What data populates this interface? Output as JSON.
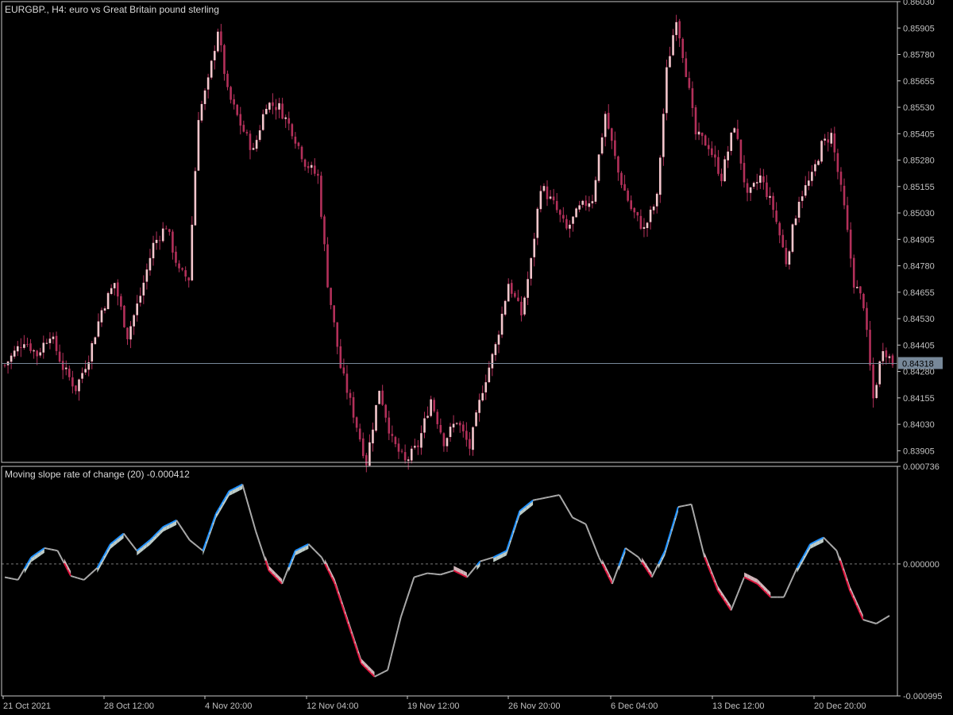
{
  "main_panel": {
    "title": "EURGBP., H4:  euro vs Great Britain pound sterling",
    "y_ticks": [
      "0.86030",
      "0.85905",
      "0.85780",
      "0.85655",
      "0.85530",
      "0.85405",
      "0.85280",
      "0.85155",
      "0.85030",
      "0.84905",
      "0.84780",
      "0.84655",
      "0.84530",
      "0.84405",
      "0.84280",
      "0.84155",
      "0.84030",
      "0.83905"
    ],
    "current_price": "0.84318"
  },
  "sub_panel": {
    "title": "Moving slope rate of change (20) -0.000412",
    "y_ticks": [
      "0.000736",
      "0.000000",
      "-0.000995"
    ]
  },
  "x_axis": {
    "labels": [
      "21 Oct 2021",
      "28 Oct 12:00",
      "4 Nov 20:00",
      "12 Nov 04:00",
      "19 Nov 12:00",
      "26 Nov 20:00",
      "6 Dec 04:00",
      "13 Dec 12:00",
      "20 Dec 20:00"
    ]
  },
  "colors": {
    "background": "#000000",
    "grid": "#c8c8c8",
    "candle_body": "#f4c6cc",
    "candle_wick": "#b3305a",
    "candle_bull_accent": "#22c55e",
    "indicator_neutral": "#a9a9a9",
    "indicator_up": "#1e90ff",
    "indicator_down": "#dc143c",
    "fill_up": "#dff0ea",
    "fill_down": "#f6d6da",
    "zero_line": "#7a7a7a",
    "price_tag_bg": "#778899"
  },
  "chart_data": [
    {
      "type": "candlestick",
      "title": "EURGBP., H4:  euro vs Great Britain pound sterling",
      "ylim": [
        0.8385,
        0.8603
      ],
      "x_range": [
        "21 Oct 2021",
        "23 Dec 2021"
      ],
      "current_price": 0.84318,
      "close_path": [
        [
          0,
          0.8431
        ],
        [
          6,
          0.8443
        ],
        [
          10,
          0.8436
        ],
        [
          14,
          0.8446
        ],
        [
          18,
          0.843
        ],
        [
          22,
          0.842
        ],
        [
          26,
          0.8435
        ],
        [
          30,
          0.8457
        ],
        [
          34,
          0.847
        ],
        [
          38,
          0.8445
        ],
        [
          42,
          0.8464
        ],
        [
          46,
          0.8488
        ],
        [
          50,
          0.8497
        ],
        [
          54,
          0.8475
        ],
        [
          57,
          0.8472
        ],
        [
          60,
          0.8549
        ],
        [
          63,
          0.8565
        ],
        [
          66,
          0.859
        ],
        [
          69,
          0.856
        ],
        [
          73,
          0.8545
        ],
        [
          77,
          0.8532
        ],
        [
          81,
          0.8555
        ],
        [
          85,
          0.8553
        ],
        [
          89,
          0.8542
        ],
        [
          93,
          0.8527
        ],
        [
          97,
          0.852
        ],
        [
          100,
          0.847
        ],
        [
          104,
          0.843
        ],
        [
          108,
          0.8408
        ],
        [
          112,
          0.8385
        ],
        [
          116,
          0.842
        ],
        [
          120,
          0.8395
        ],
        [
          124,
          0.8385
        ],
        [
          128,
          0.8393
        ],
        [
          132,
          0.8415
        ],
        [
          136,
          0.8395
        ],
        [
          140,
          0.8405
        ],
        [
          144,
          0.8392
        ],
        [
          148,
          0.842
        ],
        [
          152,
          0.844
        ],
        [
          156,
          0.847
        ],
        [
          160,
          0.8455
        ],
        [
          163,
          0.848
        ],
        [
          166,
          0.8516
        ],
        [
          170,
          0.8507
        ],
        [
          174,
          0.8495
        ],
        [
          178,
          0.8505
        ],
        [
          182,
          0.851
        ],
        [
          186,
          0.855
        ],
        [
          190,
          0.8522
        ],
        [
          194,
          0.8505
        ],
        [
          198,
          0.8495
        ],
        [
          202,
          0.851
        ],
        [
          205,
          0.857
        ],
        [
          208,
          0.8596
        ],
        [
          211,
          0.857
        ],
        [
          214,
          0.854
        ],
        [
          218,
          0.8535
        ],
        [
          222,
          0.852
        ],
        [
          226,
          0.8545
        ],
        [
          230,
          0.851
        ],
        [
          234,
          0.852
        ],
        [
          238,
          0.8505
        ],
        [
          242,
          0.848
        ],
        [
          246,
          0.851
        ],
        [
          250,
          0.852
        ],
        [
          253,
          0.8535
        ],
        [
          256,
          0.854
        ],
        [
          260,
          0.8505
        ],
        [
          263,
          0.847
        ],
        [
          266,
          0.846
        ],
        [
          269,
          0.8415
        ],
        [
          272,
          0.844
        ],
        [
          275,
          0.8432
        ]
      ]
    },
    {
      "type": "line",
      "title": "Moving slope rate of change (20) -0.000412",
      "ylim": [
        -0.000995,
        0.000736
      ],
      "current_value": -0.000412,
      "points": [
        [
          0,
          -0.0001
        ],
        [
          4,
          -0.00012
        ],
        [
          8,
          5e-05
        ],
        [
          12,
          0.00012
        ],
        [
          16,
          0.0001
        ],
        [
          20,
          -9e-05
        ],
        [
          24,
          -0.00012
        ],
        [
          28,
          -3e-05
        ],
        [
          32,
          0.00015
        ],
        [
          36,
          0.00023
        ],
        [
          40,
          0.0001
        ],
        [
          44,
          0.00018
        ],
        [
          48,
          0.00028
        ],
        [
          52,
          0.00033
        ],
        [
          56,
          0.00018
        ],
        [
          60,
          0.0001
        ],
        [
          64,
          0.00038
        ],
        [
          68,
          0.00055
        ],
        [
          72,
          0.0006
        ],
        [
          76,
          0.00025
        ],
        [
          80,
          -5e-05
        ],
        [
          84,
          -0.00015
        ],
        [
          88,
          0.0001
        ],
        [
          92,
          0.00015
        ],
        [
          96,
          5e-05
        ],
        [
          100,
          -0.00015
        ],
        [
          104,
          -0.00045
        ],
        [
          108,
          -0.00075
        ],
        [
          112,
          -0.00085
        ],
        [
          116,
          -0.0008
        ],
        [
          120,
          -0.0004
        ],
        [
          124,
          -0.0001
        ],
        [
          128,
          -7e-05
        ],
        [
          132,
          -8e-05
        ],
        [
          136,
          -5e-05
        ],
        [
          140,
          -0.0001
        ],
        [
          144,
          2e-05
        ],
        [
          148,
          5e-05
        ],
        [
          152,
          0.0001
        ],
        [
          156,
          0.0004
        ],
        [
          160,
          0.00048
        ],
        [
          164,
          0.0005
        ],
        [
          168,
          0.00052
        ],
        [
          172,
          0.00035
        ],
        [
          176,
          0.0003
        ],
        [
          180,
          5e-05
        ],
        [
          184,
          -0.00015
        ],
        [
          188,
          0.00012
        ],
        [
          192,
          5e-05
        ],
        [
          196,
          -0.0001
        ],
        [
          200,
          0.0001
        ],
        [
          204,
          0.00043
        ],
        [
          208,
          0.00045
        ],
        [
          212,
          5e-05
        ],
        [
          216,
          -0.0002
        ],
        [
          220,
          -0.00035
        ],
        [
          224,
          -0.0001
        ],
        [
          228,
          -0.00015
        ],
        [
          232,
          -0.00025
        ],
        [
          236,
          -0.00025
        ],
        [
          240,
          -3e-05
        ],
        [
          244,
          0.00015
        ],
        [
          248,
          0.0002
        ],
        [
          252,
          0.0001
        ],
        [
          256,
          -0.0002
        ],
        [
          260,
          -0.00042
        ],
        [
          264,
          -0.00045
        ],
        [
          268,
          -0.00039
        ]
      ]
    }
  ]
}
